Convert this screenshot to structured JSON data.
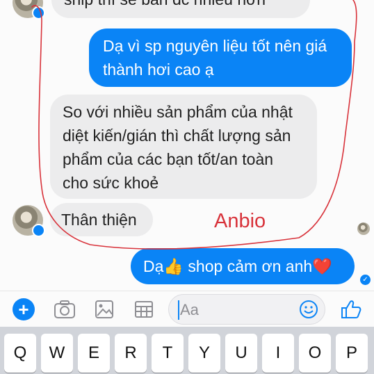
{
  "messages": [
    {
      "type": "incoming",
      "lines": [
        "ship thì sẽ bán đc nhiều hơn"
      ]
    },
    {
      "type": "outgoing",
      "lines": [
        "Dạ vì sp nguyên liệu tốt nên giá",
        "thành hơi cao ạ"
      ]
    },
    {
      "type": "incoming",
      "lines": [
        "So với nhiều sản phẩm của nhật",
        "diệt kiến/gián thì chất lượng sản",
        "phẩm của các bạn tốt/an toàn",
        "cho sức khoẻ"
      ]
    },
    {
      "type": "incoming",
      "lines": [
        "Thân thiện"
      ]
    },
    {
      "type": "outgoing",
      "lines": [
        "Dạ👍 shop cảm ơn anh❤️"
      ]
    }
  ],
  "annotation": {
    "text": "Anbio",
    "color": "#d8323a"
  },
  "composer": {
    "placeholder": "Aa",
    "icons": [
      "plus-icon",
      "camera-icon",
      "gallery-icon",
      "sticker-icon",
      "emoji-icon",
      "like-icon"
    ]
  },
  "keyboard": {
    "row1": [
      "Q",
      "W",
      "E",
      "R",
      "T",
      "Y",
      "U",
      "I",
      "O",
      "P"
    ]
  },
  "colors": {
    "accent": "#0a84f6",
    "incoming_bubble": "#ececed",
    "annotation": "#d8323a"
  }
}
